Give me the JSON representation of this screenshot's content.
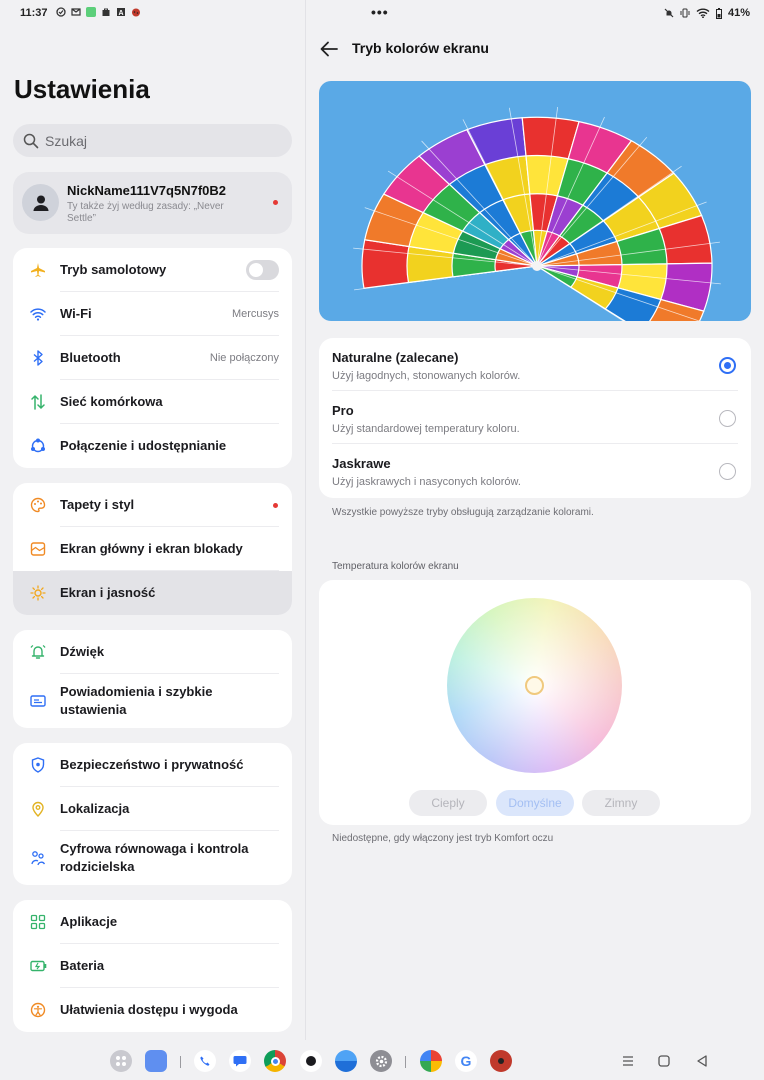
{
  "status": {
    "time": "11:37",
    "battery": "41%"
  },
  "left": {
    "title": "Ustawienia",
    "search_placeholder": "Szukaj",
    "profile": {
      "name": "NickName111V7q5N7f0B2",
      "subtitle": "Ty także żyj według zasady: „Never Settle”"
    },
    "group1": [
      {
        "label": "Tryb samolotowy",
        "icon": "airplane-icon"
      },
      {
        "label": "Wi-Fi",
        "value": "Mercusys",
        "icon": "wifi-icon"
      },
      {
        "label": "Bluetooth",
        "value": "Nie połączony",
        "icon": "bluetooth-icon"
      },
      {
        "label": "Sieć komórkowa",
        "icon": "mobile-data-icon"
      },
      {
        "label": "Połączenie i udostępnianie",
        "icon": "share-icon"
      }
    ],
    "group2": [
      {
        "label": "Tapety i styl",
        "icon": "palette-icon"
      },
      {
        "label": "Ekran główny i ekran blokady",
        "icon": "homescreen-icon"
      },
      {
        "label": "Ekran i jasność",
        "icon": "brightness-icon"
      }
    ],
    "group3": [
      {
        "label": "Dźwięk",
        "icon": "bell-icon"
      },
      {
        "label": "Powiadomienia i szybkie ustawienia",
        "icon": "notification-icon"
      }
    ],
    "group4": [
      {
        "label": "Bezpieczeństwo i prywatność",
        "icon": "shield-icon"
      },
      {
        "label": "Lokalizacja",
        "icon": "location-icon"
      },
      {
        "label": "Cyfrowa równowaga i kontrola rodzicielska",
        "icon": "family-icon"
      }
    ],
    "group5": [
      {
        "label": "Aplikacje",
        "icon": "apps-icon"
      },
      {
        "label": "Bateria",
        "icon": "battery-icon"
      },
      {
        "label": "Ułatwienia dostępu i wygoda",
        "icon": "accessibility-icon"
      }
    ]
  },
  "right": {
    "title": "Tryb kolorów ekranu",
    "modes": [
      {
        "name": "Naturalne (zalecane)",
        "desc": "Użyj łagodnych, stonowanych kolorów.",
        "selected": true
      },
      {
        "name": "Pro",
        "desc": "Użyj standardowej temperatury koloru.",
        "selected": false
      },
      {
        "name": "Jaskrawe",
        "desc": "Użyj jaskrawych i nasyconych kolorów.",
        "selected": false
      }
    ],
    "modes_note": "Wszystkie powyższe tryby obsługują zarządzanie kolorami.",
    "temp_label": "Temperatura kolorów ekranu",
    "temp_buttons": {
      "warm": "Cieply",
      "default": "Domyślne",
      "cold": "Zimny"
    },
    "temp_note": "Niedostępne, gdy włączony jest tryb Komfort oczu"
  },
  "colors": {
    "accent": "#2f6ff5",
    "red_dot": "#e53935"
  }
}
